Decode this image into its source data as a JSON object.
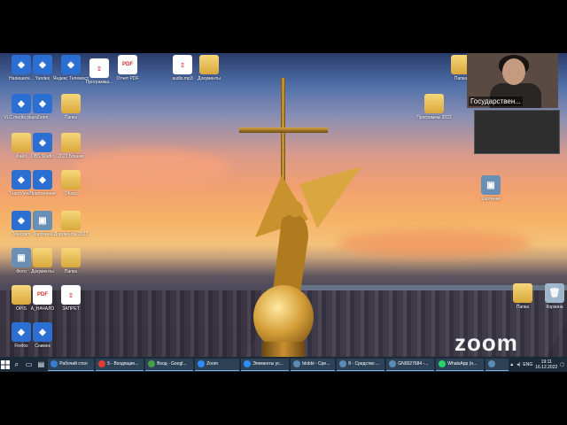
{
  "desktop_icons": [
    {
      "label": "Напишите...",
      "type": "app"
    },
    {
      "label": "Yandex",
      "type": "app"
    },
    {
      "label": "Яндекс Телемост",
      "type": "app"
    },
    {
      "label": "Программа...",
      "type": "file"
    },
    {
      "label": "Отчет PDF",
      "type": "pdf"
    },
    {
      "label": "VLC media player",
      "type": "app"
    },
    {
      "label": "Zoom",
      "type": "app"
    },
    {
      "label": "Папка",
      "type": "folder"
    },
    {
      "label": "Файл",
      "type": "folder"
    },
    {
      "label": "OBS Studio",
      "type": "app"
    },
    {
      "label": "2023 Бланки",
      "type": "folder"
    },
    {
      "label": "TeamViewer",
      "type": "app"
    },
    {
      "label": "Приложения",
      "type": "app"
    },
    {
      "label": "Обзор",
      "type": "folder"
    },
    {
      "label": "Telegram",
      "type": "app"
    },
    {
      "label": "Картинка",
      "type": "image"
    },
    {
      "label": "Документы 2022",
      "type": "folder"
    },
    {
      "label": "Фото",
      "type": "image"
    },
    {
      "label": "Документы",
      "type": "folder"
    },
    {
      "label": "Папка",
      "type": "folder"
    },
    {
      "label": "OPIS",
      "type": "folder"
    },
    {
      "label": "A_НАЧАЛО",
      "type": "pdf"
    },
    {
      "label": "ЗАПРЕТ",
      "type": "file"
    },
    {
      "label": "Firefox",
      "type": "app"
    },
    {
      "label": "Снимок",
      "type": "app"
    },
    {
      "label": "audio.mp3",
      "type": "file"
    },
    {
      "label": "Документы",
      "type": "folder"
    },
    {
      "label": "Папка",
      "type": "folder"
    },
    {
      "label": "Программы 2022",
      "type": "folder"
    },
    {
      "label": "Картинки",
      "type": "image"
    },
    {
      "label": "Папка",
      "type": "folder"
    },
    {
      "label": "Корзина",
      "type": "trash"
    }
  ],
  "zoom": {
    "participant_name": "Государствен...",
    "watermark": "zoom"
  },
  "taskbar": {
    "items": [
      {
        "label": "Рабочий стол",
        "color": "#3a7bd5"
      },
      {
        "label": "5 - Входящие...",
        "color": "#e53935"
      },
      {
        "label": "Вход - Googl...",
        "color": "#43a047"
      },
      {
        "label": "Zoom",
        "color": "#2d8cff"
      },
      {
        "label": "Элементы ус...",
        "color": "#2d8cff"
      },
      {
        "label": "blobbi - Сре...",
        "color": "#5c8bb8"
      },
      {
        "label": "8 - Средство ...",
        "color": "#5c8bb8"
      },
      {
        "label": "GN0027684 -...",
        "color": "#5c8bb8"
      },
      {
        "label": "WhatsApp (n...",
        "color": "#25d366"
      },
      {
        "label": "",
        "color": "#5c8bb8"
      }
    ],
    "lang": "ENG",
    "time": "19:11",
    "date": "16.12.2022"
  }
}
